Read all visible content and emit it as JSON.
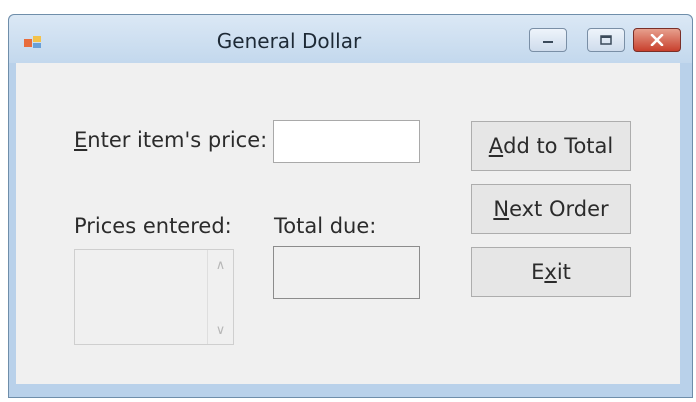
{
  "window": {
    "title": "General Dollar",
    "controls": {
      "minimize": "minimize-icon",
      "maximize": "maximize-icon",
      "close": "close-icon"
    }
  },
  "form": {
    "price_label": {
      "mnemonic": "E",
      "rest": "nter item's price:"
    },
    "price_input": {
      "value": ""
    },
    "prices_entered_label": "Prices entered:",
    "prices_entered_items": [],
    "total_due_label": "Total due:",
    "total_due_value": ""
  },
  "buttons": {
    "add": {
      "mnemonic": "A",
      "rest": "dd to Total"
    },
    "next": {
      "mnemonic": "N",
      "rest": "ext Order"
    },
    "exit": {
      "before": "E",
      "mnemonic": "x",
      "after": "it"
    }
  },
  "colors": {
    "titlebar": "#c3d8ed",
    "client": "#f0f0f0",
    "close_button": "#c8402d"
  }
}
